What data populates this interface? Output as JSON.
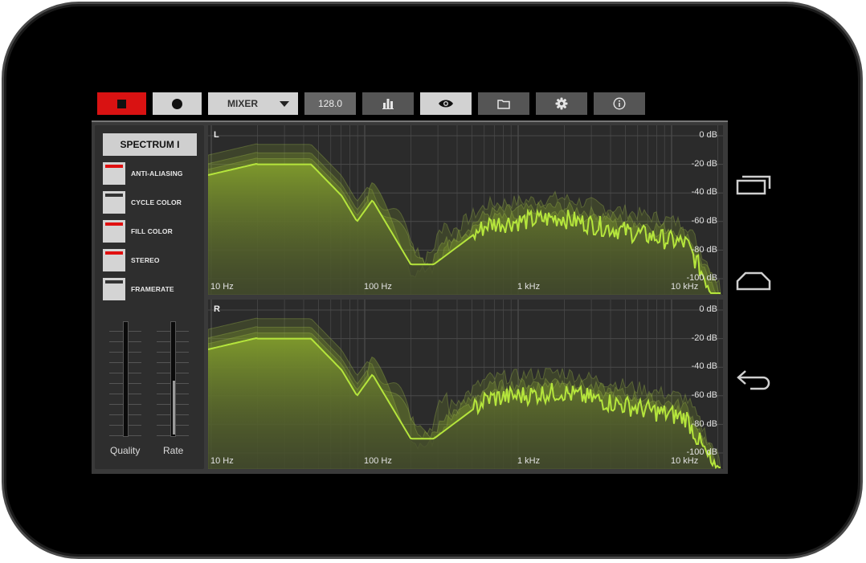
{
  "toolbar": {
    "mixer_label": "MIXER",
    "bpm": "128.0",
    "stop_color": "#d91212"
  },
  "sidebar": {
    "title_button": "SPECTRUM I",
    "options": [
      {
        "label": "ANTI-ALIASING",
        "checked": true
      },
      {
        "label": "CYCLE COLOR",
        "checked": false
      },
      {
        "label": "FILL COLOR",
        "checked": true
      },
      {
        "label": "STEREO",
        "checked": true
      },
      {
        "label": "FRAMERATE",
        "checked": false
      }
    ],
    "sliders": [
      {
        "label": "Quality",
        "level": 0.0
      },
      {
        "label": "Rate",
        "level": 0.48
      }
    ]
  },
  "spectrum": {
    "channels": [
      "L",
      "R"
    ],
    "db_labels": [
      "0 dB",
      "-20 dB",
      "-40 dB",
      "-60 dB",
      "-80 dB",
      "-100 dB"
    ],
    "hz_labels": [
      "10 Hz",
      "100 Hz",
      "1 kHz",
      "10 kHz"
    ],
    "line_color": "#b5e53c",
    "fill_color": "#7f9a2c"
  },
  "icons": [
    "stop-icon",
    "record-icon",
    "dropdown-caret-icon",
    "bar-chart-icon",
    "eye-icon",
    "folder-icon",
    "gear-icon",
    "info-icon",
    "recent-apps-icon",
    "home-icon",
    "back-icon"
  ]
}
